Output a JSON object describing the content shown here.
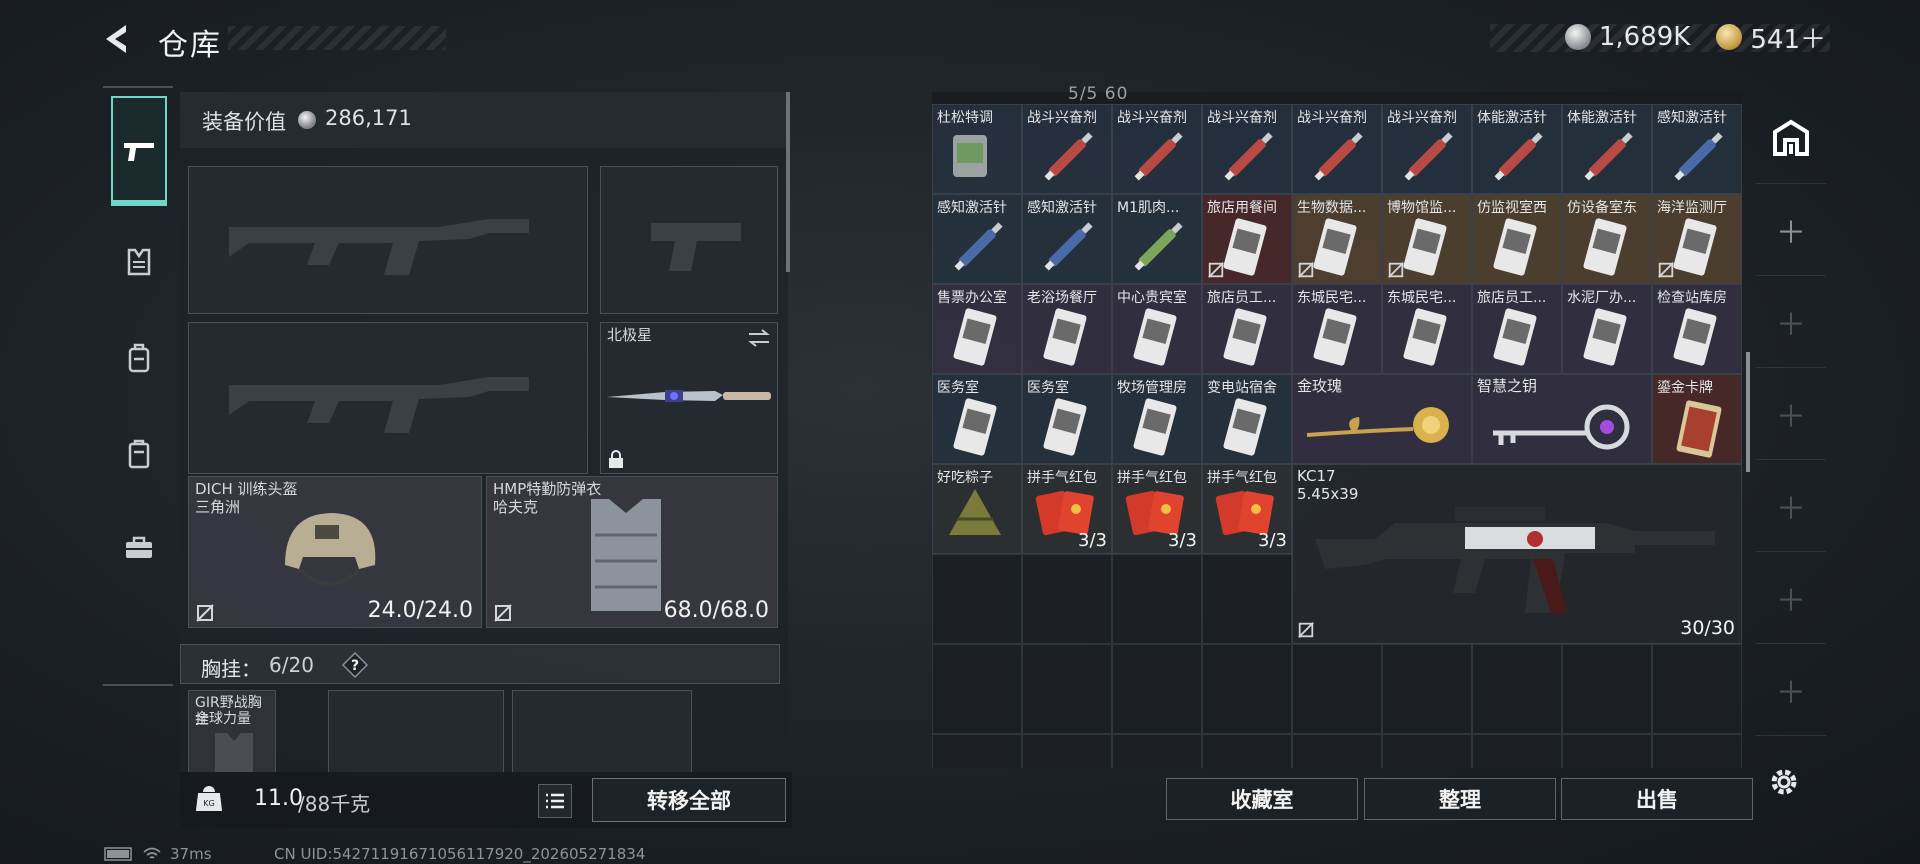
{
  "header": {
    "title": "仓库",
    "currency": [
      {
        "name": "silver-coin",
        "value": "1,689K"
      },
      {
        "name": "gold-coin",
        "value": "541＋"
      }
    ]
  },
  "left_nav": {
    "items": [
      {
        "icon": "pistol-icon",
        "active": true
      },
      {
        "icon": "armor-vest-icon",
        "active": false
      },
      {
        "icon": "backpack-icon",
        "active": false
      },
      {
        "icon": "case-icon",
        "active": false
      },
      {
        "icon": "toolbox-icon",
        "active": false
      }
    ]
  },
  "loadout": {
    "equip_value_label": "装备价值",
    "equip_value": "286,171",
    "melee": {
      "label": "北极星"
    },
    "helmet": {
      "name": "DICH 训练头盔",
      "brand": "三角洲",
      "durability": "24.0/24.0"
    },
    "armor": {
      "name": "HMP特勤防弹衣",
      "brand": "哈夫克",
      "durability": "68.0/68.0"
    },
    "chest_rig": {
      "label": "胸挂：",
      "count": "6/20",
      "help": "?"
    },
    "chest_item": {
      "name": "GIR野战胸挂",
      "brand": "全球力量"
    },
    "weight_current": "11.0",
    "weight_max": "/88千克",
    "transfer_all": "转移全部"
  },
  "storage": {
    "top_partial": "5/5   60",
    "rows": [
      [
        {
          "name": "杜松特调",
          "color": "blue",
          "icon": "drink-icon"
        },
        {
          "name": "战斗兴奋剂",
          "color": "blue",
          "icon": "injector-red-icon"
        },
        {
          "name": "战斗兴奋剂",
          "color": "blue",
          "icon": "injector-red-icon"
        },
        {
          "name": "战斗兴奋剂",
          "color": "blue",
          "icon": "injector-red-icon"
        },
        {
          "name": "战斗兴奋剂",
          "color": "blue",
          "icon": "injector-red-icon"
        },
        {
          "name": "战斗兴奋剂",
          "color": "blue",
          "icon": "injector-red-icon"
        },
        {
          "name": "体能激活针",
          "color": "blue",
          "icon": "injector-red-icon"
        },
        {
          "name": "体能激活针",
          "color": "blue",
          "icon": "injector-red-icon"
        },
        {
          "name": "感知激活针",
          "color": "blue",
          "icon": "injector-blue-icon"
        }
      ],
      [
        {
          "name": "感知激活针",
          "color": "blue",
          "icon": "injector-blue-icon"
        },
        {
          "name": "感知激活针",
          "color": "blue",
          "icon": "injector-blue-icon"
        },
        {
          "name": "M1肌肉...",
          "color": "blue",
          "icon": "injector-green-icon"
        },
        {
          "name": "旅店用餐间",
          "color": "red",
          "icon": "keycard-icon"
        },
        {
          "name": "生物数据...",
          "color": "orange",
          "icon": "keycard-icon"
        },
        {
          "name": "博物馆监...",
          "color": "orange",
          "icon": "keycard-icon"
        },
        {
          "name": "仿监视室西",
          "color": "orange",
          "icon": "keycard-icon"
        },
        {
          "name": "仿设备室东",
          "color": "orange",
          "icon": "keycard-icon"
        },
        {
          "name": "海洋监测厅",
          "color": "orange",
          "icon": "keycard-icon"
        }
      ],
      [
        {
          "name": "售票办公室",
          "color": "purple",
          "icon": "keycard-icon"
        },
        {
          "name": "老浴场餐厅",
          "color": "purple",
          "icon": "keycard-icon"
        },
        {
          "name": "中心贵宾室",
          "color": "purple",
          "icon": "keycard-icon"
        },
        {
          "name": "旅店员工...",
          "color": "purple",
          "icon": "keycard-icon"
        },
        {
          "name": "东城民宅...",
          "color": "purple",
          "icon": "keycard-icon"
        },
        {
          "name": "东城民宅...",
          "color": "purple",
          "icon": "keycard-icon"
        },
        {
          "name": "旅店员工...",
          "color": "purple",
          "icon": "keycard-icon"
        },
        {
          "name": "水泥厂办...",
          "color": "purple",
          "icon": "keycard-icon"
        },
        {
          "name": "检查站库房",
          "color": "purple",
          "icon": "keycard-icon"
        }
      ],
      [
        {
          "name": "医务室",
          "color": "blue",
          "icon": "keycard-icon"
        },
        {
          "name": "医务室",
          "color": "blue",
          "icon": "keycard-icon"
        },
        {
          "name": "牧场管理房",
          "color": "blue",
          "icon": "keycard-icon"
        },
        {
          "name": "变电站宿舍",
          "color": "blue",
          "icon": "keycard-icon"
        }
      ],
      [
        {
          "name": "好吃粽子",
          "color": "gray",
          "icon": "zongzi-icon"
        },
        {
          "name": "拼手气红包",
          "color": "gray",
          "icon": "red-envelope-icon",
          "qty": "3/3"
        },
        {
          "name": "拼手气红包",
          "color": "gray",
          "icon": "red-envelope-icon",
          "qty": "3/3"
        },
        {
          "name": "拼手气红包",
          "color": "gray",
          "icon": "red-envelope-icon",
          "qty": "3/3"
        }
      ]
    ],
    "golden_rose": {
      "name": "金玫瑰"
    },
    "wisdom_key": {
      "name": "智慧之钥"
    },
    "gold_card": {
      "name": "鎏金卡牌"
    },
    "rifle": {
      "name": "KC17",
      "caliber": "5.45x39",
      "ammo": "30/30"
    }
  },
  "bottom_buttons": {
    "collection": "收藏室",
    "organize": "整理",
    "sell": "出售"
  },
  "status": {
    "ping": "37ms",
    "uid": "CN UID:542711916710561179​20_202605271834"
  },
  "colors": {
    "accent": "#6fd6c8",
    "background": "#1d2227"
  }
}
